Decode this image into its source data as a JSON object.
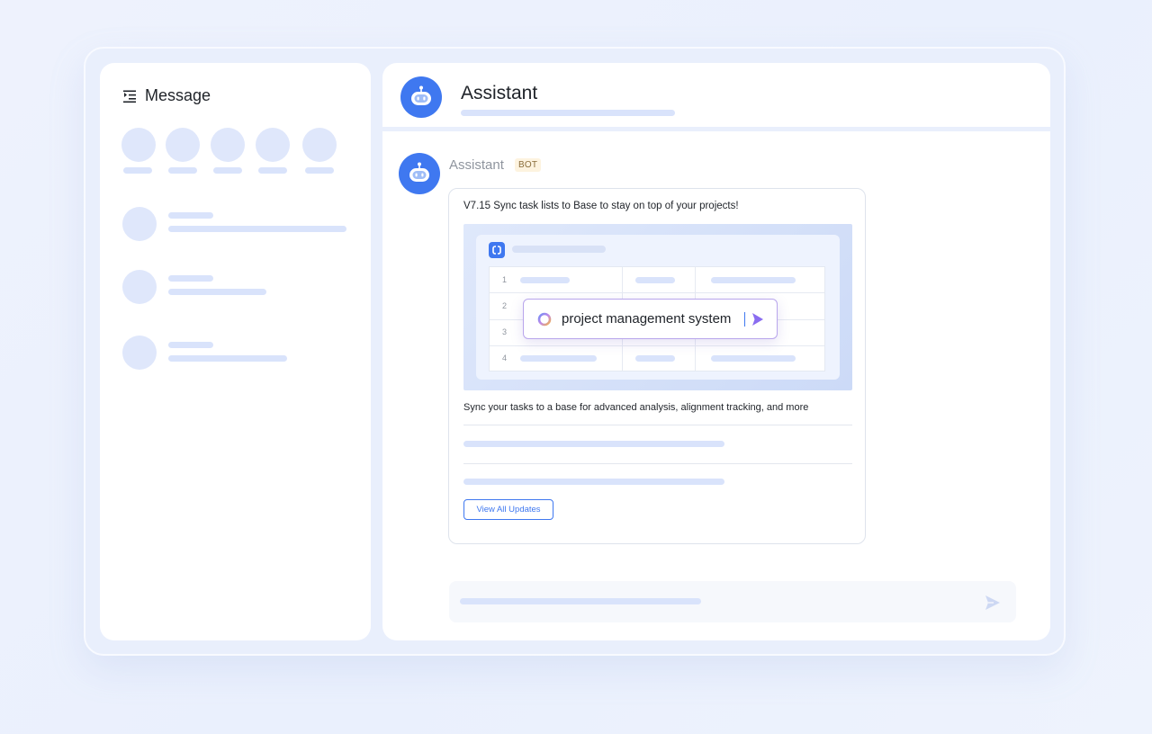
{
  "sidebar": {
    "title": "Message",
    "title_icon": "list-indent-icon"
  },
  "header": {
    "title": "Assistant",
    "avatar_icon": "robot-icon"
  },
  "message": {
    "sender": "Assistant",
    "badge": "BOT",
    "card": {
      "title": "V7.15 Sync task lists to Base to stay on top of your projects!",
      "preview": {
        "row_numbers": [
          "1",
          "2",
          "3",
          "4"
        ],
        "search_text": "project management system",
        "search_icon": "loading-ring-icon",
        "send_icon": "send-icon"
      },
      "description": "Sync your tasks to a base for advanced analysis, alignment tracking, and more",
      "button_label": "View All Updates"
    }
  },
  "composer": {
    "send_icon": "send-icon"
  },
  "colors": {
    "accent": "#3F78F0",
    "skeleton": "#D9E3FB",
    "badge_bg": "#FDF3DF"
  }
}
